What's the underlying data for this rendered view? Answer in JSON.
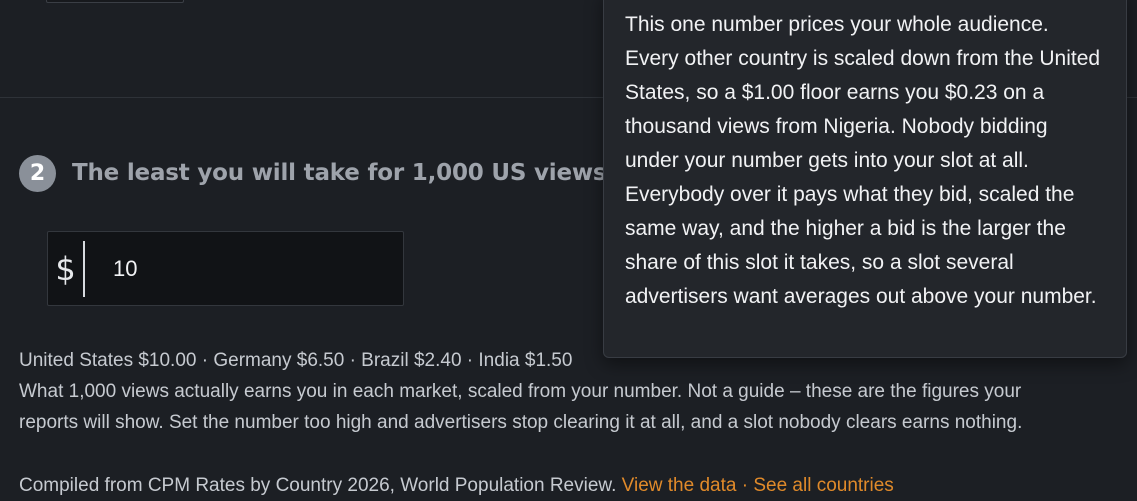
{
  "step": {
    "number": "2",
    "title": "The least you will take for 1,000 US views",
    "info_glyph": "?",
    "info_icon": "info-icon"
  },
  "price": {
    "currency": "$",
    "value": "10"
  },
  "summary": {
    "market_rates": "United States $10.00 · Germany $6.50 · Brazil $2.40 · India $1.50",
    "explanation": "What 1,000 views actually earns you in each market, scaled from your number. Not a guide – these are the figures your reports will show. Set the number too high and advertisers stop clearing it at all, and a slot nobody clears earns nothing."
  },
  "source": {
    "text": "Compiled from CPM Rates by Country 2026, World Population Review.",
    "view_data_link": "View the data",
    "separator": "·",
    "all_countries_link": "See all countries"
  },
  "tooltip": {
    "text": "This one number prices your whole audience. Every other country is scaled down from the United States, so a $1.00 floor earns you $0.23 on a thousand views from Nigeria. Nobody bidding under your number gets into your slot at all. Everybody over it pays what they bid, scaled the same way, and the higher a bid is the larger the share of this slot it takes, so a slot several advertisers want averages out above your number."
  },
  "colors": {
    "background": "#1c1f24",
    "accent_link": "#e08a2a",
    "badge": "#8a9099",
    "tooltip_bg": "#23262b"
  }
}
